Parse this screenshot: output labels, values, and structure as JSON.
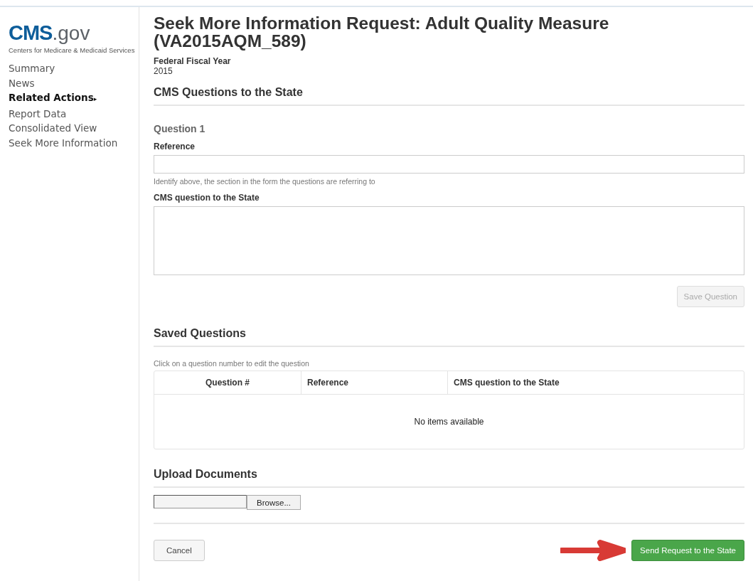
{
  "logo": {
    "brand": "CMS",
    "suffix": ".gov",
    "tagline": "Centers for Medicare & Medicaid Services"
  },
  "sidebar": {
    "items": [
      {
        "label": "Summary",
        "selected": false
      },
      {
        "label": "News",
        "selected": false
      },
      {
        "label": "Related Actions",
        "selected": true,
        "marker": "▸"
      },
      {
        "label": "Report Data",
        "selected": false
      },
      {
        "label": "Consolidated View",
        "selected": false
      },
      {
        "label": "Seek More Information",
        "selected": false
      }
    ]
  },
  "page": {
    "title": "Seek More Information Request: Adult Quality Measure (VA2015AQM_589)",
    "fiscal_year_label": "Federal Fiscal Year",
    "fiscal_year": "2015"
  },
  "questions_section": {
    "heading": "CMS Questions to the State",
    "question_title": "Question 1",
    "reference_label": "Reference",
    "reference_help": "Identify above, the section in the form the questions are referring to",
    "question_label": "CMS question to the State",
    "save_button": {
      "label": "Save Question",
      "disabled": true
    }
  },
  "saved_questions": {
    "heading": "Saved Questions",
    "hint": "Click on a question number to edit the question",
    "columns": [
      "Question #",
      "Reference",
      "CMS question to the State"
    ],
    "empty_text": "No items available"
  },
  "upload": {
    "heading": "Upload Documents",
    "browse_button": "Browse..."
  },
  "footer": {
    "cancel_button": "Cancel",
    "send_button": "Send Request to the State"
  }
}
